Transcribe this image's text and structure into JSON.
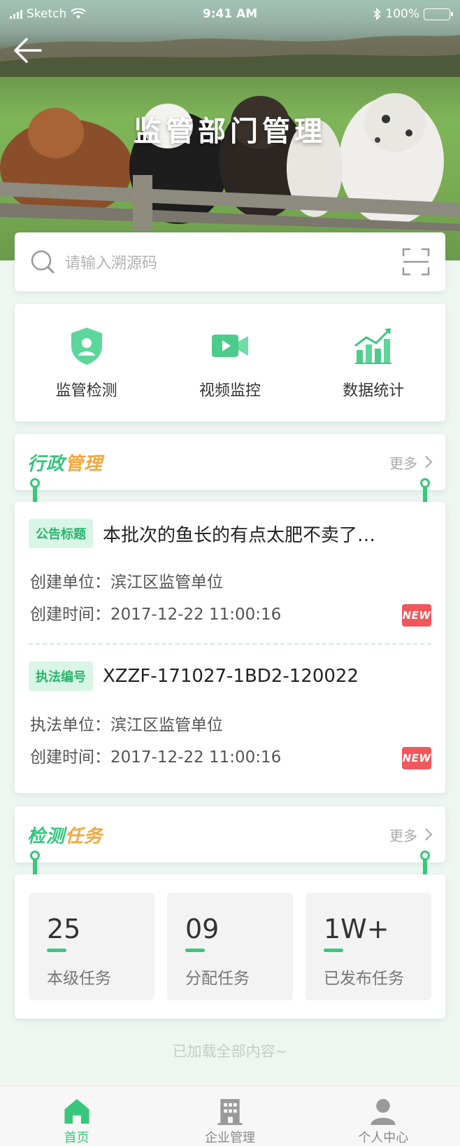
{
  "status_bar": {
    "carrier": "Sketch",
    "time": "9:41 AM",
    "battery": "100%"
  },
  "header": {
    "title": "监管部门管理"
  },
  "search": {
    "placeholder": "请输入溯源码"
  },
  "quick_actions": [
    {
      "label": "监管检测",
      "icon": "shield-user-icon"
    },
    {
      "label": "视频监控",
      "icon": "video-camera-icon"
    },
    {
      "label": "数据统计",
      "icon": "chart-growth-icon"
    }
  ],
  "admin_section": {
    "title_part1": "行政",
    "title_part2": "管理",
    "more": "更多",
    "items": [
      {
        "tag": "公告标题",
        "title": "本批次的鱼长的有点太肥不卖了…",
        "line1": "创建单位：滨江区监管单位",
        "line2": "创建时间：2017-12-22 11:00:16",
        "badge": "NEW"
      },
      {
        "tag": "执法编号",
        "title": "XZZF-171027-1BD2-120022",
        "line1": "执法单位：滨江区监管单位",
        "line2": "创建时间：2017-12-22 11:00:16",
        "badge": "NEW"
      }
    ]
  },
  "task_section": {
    "title_part1": "检测",
    "title_part2": "任务",
    "more": "更多",
    "tasks": [
      {
        "value": "25",
        "label": "本级任务"
      },
      {
        "value": "09",
        "label": "分配任务"
      },
      {
        "value": "1W+",
        "label": "已发布任务"
      }
    ]
  },
  "footer_note": "已加载全部内容~",
  "tabbar": [
    {
      "label": "首页",
      "icon": "home-icon",
      "active": true
    },
    {
      "label": "企业管理",
      "icon": "building-icon",
      "active": false
    },
    {
      "label": "个人中心",
      "icon": "user-icon",
      "active": false
    }
  ],
  "colors": {
    "accent": "#38c77d",
    "orange": "#f4a63a",
    "new_badge": "#f2575b"
  }
}
